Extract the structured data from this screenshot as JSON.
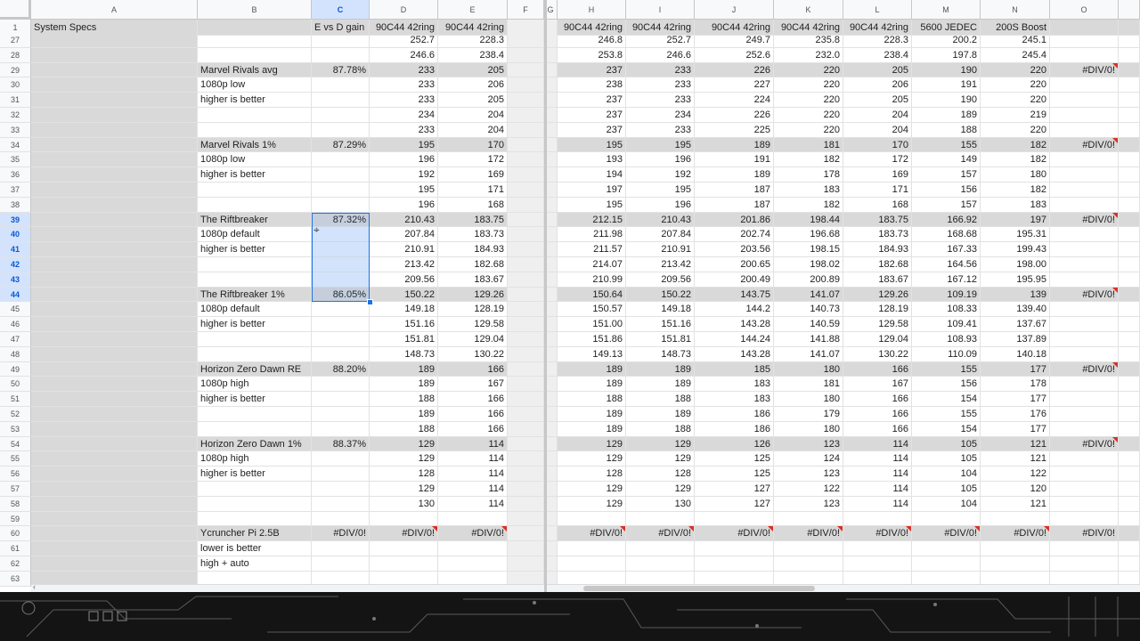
{
  "columns": [
    "A",
    "B",
    "C",
    "D",
    "E",
    "F",
    "G",
    "H",
    "I",
    "J",
    "K",
    "L",
    "M",
    "N",
    "O"
  ],
  "selected_column": "C",
  "header_row": {
    "row": "1",
    "cells": {
      "A": "System Specs",
      "B": "",
      "C": "E vs D gain",
      "D": "90C44 42ring",
      "E": "90C44 42ring",
      "F": "",
      "G": "",
      "H": "90C44 42ring",
      "I": "90C44 42ring",
      "J": "90C44 42ring",
      "K": "90C44 42ring",
      "L": "90C44 42ring",
      "M": "5600 JEDEC",
      "N": "200S Boost",
      "O": ""
    }
  },
  "selected_rows": [
    "39",
    "40",
    "41",
    "42",
    "43",
    "44"
  ],
  "rows": [
    {
      "n": "27",
      "cells": {
        "D": "252.7",
        "E": "228.3",
        "H": "246.8",
        "I": "252.7",
        "J": "249.7",
        "K": "235.8",
        "L": "228.3",
        "M": "200.2",
        "N": "245.1"
      }
    },
    {
      "n": "28",
      "cells": {
        "D": "246.6",
        "E": "238.4",
        "H": "253.8",
        "I": "246.6",
        "J": "252.6",
        "K": "232.0",
        "L": "238.4",
        "M": "197.8",
        "N": "245.4"
      }
    },
    {
      "n": "29",
      "grey": true,
      "cells": {
        "B": "Marvel Rivals avg",
        "C": "87.78%",
        "D": "233",
        "E": "205",
        "H": "237",
        "I": "233",
        "J": "226",
        "K": "220",
        "L": "205",
        "M": "190",
        "N": "220",
        "O": "#DIV/0!"
      },
      "err": [
        "O"
      ]
    },
    {
      "n": "30",
      "cells": {
        "B": "1080p low",
        "D": "233",
        "E": "206",
        "H": "238",
        "I": "233",
        "J": "227",
        "K": "220",
        "L": "206",
        "M": "191",
        "N": "220"
      }
    },
    {
      "n": "31",
      "cells": {
        "B": "higher is better",
        "D": "233",
        "E": "205",
        "H": "237",
        "I": "233",
        "J": "224",
        "K": "220",
        "L": "205",
        "M": "190",
        "N": "220"
      }
    },
    {
      "n": "32",
      "cells": {
        "D": "234",
        "E": "204",
        "H": "237",
        "I": "234",
        "J": "226",
        "K": "220",
        "L": "204",
        "M": "189",
        "N": "219"
      }
    },
    {
      "n": "33",
      "cells": {
        "D": "233",
        "E": "204",
        "H": "237",
        "I": "233",
        "J": "225",
        "K": "220",
        "L": "204",
        "M": "188",
        "N": "220"
      }
    },
    {
      "n": "34",
      "grey": true,
      "cells": {
        "B": "Marvel Rivals 1%",
        "C": "87.29%",
        "D": "195",
        "E": "170",
        "H": "195",
        "I": "195",
        "J": "189",
        "K": "181",
        "L": "170",
        "M": "155",
        "N": "182",
        "O": "#DIV/0!"
      },
      "err": [
        "O"
      ]
    },
    {
      "n": "35",
      "cells": {
        "B": "1080p low",
        "D": "196",
        "E": "172",
        "H": "193",
        "I": "196",
        "J": "191",
        "K": "182",
        "L": "172",
        "M": "149",
        "N": "182"
      }
    },
    {
      "n": "36",
      "cells": {
        "B": "higher is better",
        "D": "192",
        "E": "169",
        "H": "194",
        "I": "192",
        "J": "189",
        "K": "178",
        "L": "169",
        "M": "157",
        "N": "180"
      }
    },
    {
      "n": "37",
      "cells": {
        "D": "195",
        "E": "171",
        "H": "197",
        "I": "195",
        "J": "187",
        "K": "183",
        "L": "171",
        "M": "156",
        "N": "182"
      }
    },
    {
      "n": "38",
      "cells": {
        "D": "196",
        "E": "168",
        "H": "195",
        "I": "196",
        "J": "187",
        "K": "182",
        "L": "168",
        "M": "157",
        "N": "183"
      }
    },
    {
      "n": "39",
      "grey": true,
      "cells": {
        "B": "The Riftbreaker",
        "C": "87.32%",
        "D": "210.43",
        "E": "183.75",
        "H": "212.15",
        "I": "210.43",
        "J": "201.86",
        "K": "198.44",
        "L": "183.75",
        "M": "166.92",
        "N": "197",
        "O": "#DIV/0!"
      },
      "err": [
        "O"
      ]
    },
    {
      "n": "40",
      "cells": {
        "B": "1080p default",
        "D": "207.84",
        "E": "183.73",
        "H": "211.98",
        "I": "207.84",
        "J": "202.74",
        "K": "196.68",
        "L": "183.73",
        "M": "168.68",
        "N": "195.31"
      }
    },
    {
      "n": "41",
      "cells": {
        "B": "higher is better",
        "D": "210.91",
        "E": "184.93",
        "H": "211.57",
        "I": "210.91",
        "J": "203.56",
        "K": "198.15",
        "L": "184.93",
        "M": "167.33",
        "N": "199.43"
      }
    },
    {
      "n": "42",
      "cells": {
        "D": "213.42",
        "E": "182.68",
        "H": "214.07",
        "I": "213.42",
        "J": "200.65",
        "K": "198.02",
        "L": "182.68",
        "M": "164.56",
        "N": "198.00"
      }
    },
    {
      "n": "43",
      "cells": {
        "D": "209.56",
        "E": "183.67",
        "H": "210.99",
        "I": "209.56",
        "J": "200.49",
        "K": "200.89",
        "L": "183.67",
        "M": "167.12",
        "N": "195.95"
      }
    },
    {
      "n": "44",
      "grey": true,
      "cells": {
        "B": "The Riftbreaker 1%",
        "C": "86.05%",
        "D": "150.22",
        "E": "129.26",
        "H": "150.64",
        "I": "150.22",
        "J": "143.75",
        "K": "141.07",
        "L": "129.26",
        "M": "109.19",
        "N": "139",
        "O": "#DIV/0!"
      },
      "err": [
        "O"
      ]
    },
    {
      "n": "45",
      "cells": {
        "B": "1080p default",
        "D": "149.18",
        "E": "128.19",
        "H": "150.57",
        "I": "149.18",
        "J": "144.2",
        "K": "140.73",
        "L": "128.19",
        "M": "108.33",
        "N": "139.40"
      }
    },
    {
      "n": "46",
      "cells": {
        "B": "higher is better",
        "D": "151.16",
        "E": "129.58",
        "H": "151.00",
        "I": "151.16",
        "J": "143.28",
        "K": "140.59",
        "L": "129.58",
        "M": "109.41",
        "N": "137.67"
      }
    },
    {
      "n": "47",
      "cells": {
        "D": "151.81",
        "E": "129.04",
        "H": "151.86",
        "I": "151.81",
        "J": "144.24",
        "K": "141.88",
        "L": "129.04",
        "M": "108.93",
        "N": "137.89"
      }
    },
    {
      "n": "48",
      "cells": {
        "D": "148.73",
        "E": "130.22",
        "H": "149.13",
        "I": "148.73",
        "J": "143.28",
        "K": "141.07",
        "L": "130.22",
        "M": "110.09",
        "N": "140.18"
      }
    },
    {
      "n": "49",
      "grey": true,
      "cells": {
        "B": "Horizon Zero Dawn RE",
        "C": "88.20%",
        "D": "189",
        "E": "166",
        "H": "189",
        "I": "189",
        "J": "185",
        "K": "180",
        "L": "166",
        "M": "155",
        "N": "177",
        "O": "#DIV/0!"
      },
      "err": [
        "O"
      ]
    },
    {
      "n": "50",
      "cells": {
        "B": "1080p high",
        "D": "189",
        "E": "167",
        "H": "189",
        "I": "189",
        "J": "183",
        "K": "181",
        "L": "167",
        "M": "156",
        "N": "178"
      }
    },
    {
      "n": "51",
      "cells": {
        "B": "higher is better",
        "D": "188",
        "E": "166",
        "H": "188",
        "I": "188",
        "J": "183",
        "K": "180",
        "L": "166",
        "M": "154",
        "N": "177"
      }
    },
    {
      "n": "52",
      "cells": {
        "D": "189",
        "E": "166",
        "H": "189",
        "I": "189",
        "J": "186",
        "K": "179",
        "L": "166",
        "M": "155",
        "N": "176"
      }
    },
    {
      "n": "53",
      "cells": {
        "D": "188",
        "E": "166",
        "H": "189",
        "I": "188",
        "J": "186",
        "K": "180",
        "L": "166",
        "M": "154",
        "N": "177"
      }
    },
    {
      "n": "54",
      "grey": true,
      "cells": {
        "B": "Horizon Zero Dawn 1%",
        "C": "88.37%",
        "D": "129",
        "E": "114",
        "H": "129",
        "I": "129",
        "J": "126",
        "K": "123",
        "L": "114",
        "M": "105",
        "N": "121",
        "O": "#DIV/0!"
      },
      "err": [
        "O"
      ]
    },
    {
      "n": "55",
      "cells": {
        "B": "1080p high",
        "D": "129",
        "E": "114",
        "H": "129",
        "I": "129",
        "J": "125",
        "K": "124",
        "L": "114",
        "M": "105",
        "N": "121"
      }
    },
    {
      "n": "56",
      "cells": {
        "B": "higher is better",
        "D": "128",
        "E": "114",
        "H": "128",
        "I": "128",
        "J": "125",
        "K": "123",
        "L": "114",
        "M": "104",
        "N": "122"
      }
    },
    {
      "n": "57",
      "cells": {
        "D": "129",
        "E": "114",
        "H": "129",
        "I": "129",
        "J": "127",
        "K": "122",
        "L": "114",
        "M": "105",
        "N": "120"
      }
    },
    {
      "n": "58",
      "cells": {
        "D": "130",
        "E": "114",
        "H": "129",
        "I": "130",
        "J": "127",
        "K": "123",
        "L": "114",
        "M": "104",
        "N": "121"
      }
    },
    {
      "n": "59",
      "cells": {}
    },
    {
      "n": "60",
      "grey": true,
      "cells": {
        "B": "Ycruncher Pi 2.5B",
        "C": "#DIV/0!",
        "D": "#DIV/0!",
        "E": "#DIV/0!",
        "H": "#DIV/0!",
        "I": "#DIV/0!",
        "J": "#DIV/0!",
        "K": "#DIV/0!",
        "L": "#DIV/0!",
        "M": "#DIV/0!",
        "N": "#DIV/0!",
        "O": "#DIV/0!"
      },
      "err": [
        "D",
        "E",
        "H",
        "I",
        "J",
        "K",
        "L",
        "M",
        "N"
      ]
    },
    {
      "n": "61",
      "cells": {
        "B": "lower is better"
      }
    },
    {
      "n": "62",
      "cells": {
        "B": "high + auto"
      }
    },
    {
      "n": "63",
      "cells": {}
    }
  ],
  "colors": {
    "header_fill": "#d9d9d9",
    "selection": "#1a73e8",
    "error_flag": "#d93025"
  },
  "icons": {
    "scroll_left": "chevron-left-icon",
    "cursor": "cross-cursor-icon"
  }
}
